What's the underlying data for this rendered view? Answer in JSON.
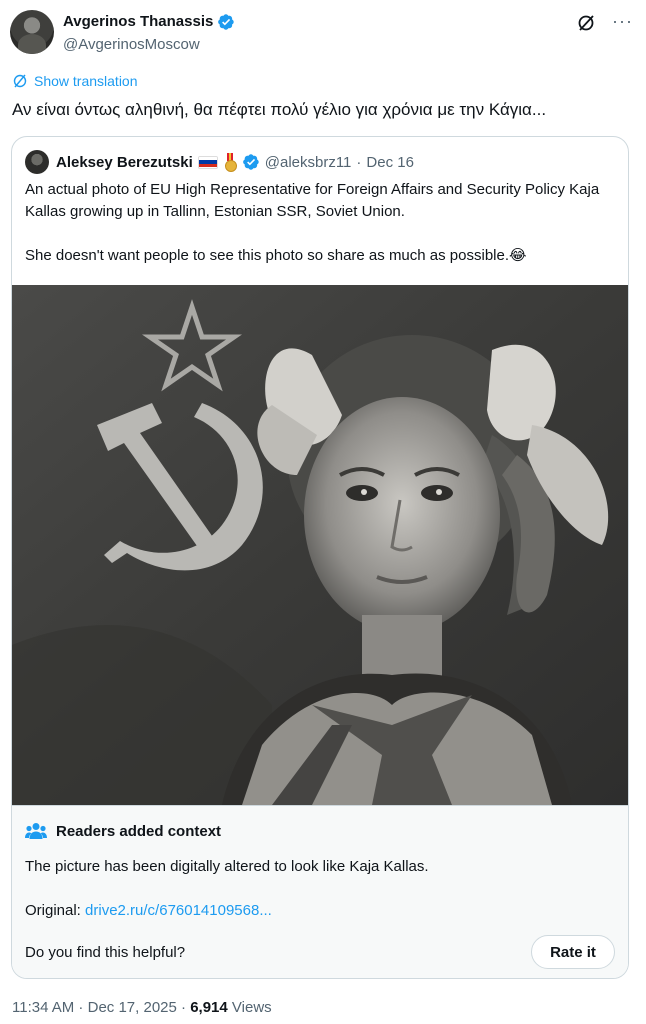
{
  "author": {
    "display_name": "Avgerinos Thanassis",
    "handle": "@AvgerinosMoscow",
    "verified": true
  },
  "translation_link": "Show translation",
  "tweet_text": "Αν είναι όντως αληθινή, θα πέφτει πολύ γέλιο για χρόνια με την Κάγια...",
  "quoted": {
    "display_name": "Aleksey Berezutski",
    "flag_icon": "russia-flag-icon",
    "medal_icon": "medal-icon",
    "handle": "@aleksbrz11",
    "separator": "·",
    "date": "Dec 16",
    "text_p1": "An actual photo of EU High Representative for Foreign Affairs and Security Policy Kaja Kallas growing up in Tallinn, Estonian SSR, Soviet Union.",
    "text_p2": "She doesn't want people to see this photo so share as much as possible.😂"
  },
  "context": {
    "title": "Readers added context",
    "body": "The picture has been digitally altered to look like Kaja Kallas.",
    "original_label": "Original:",
    "original_link": "drive2.ru/c/676014109568...",
    "helpful_question": "Do you find this helpful?",
    "rate_button": "Rate it"
  },
  "footer": {
    "time": "11:34 AM",
    "sep1": " · ",
    "date": "Dec 17, 2025",
    "sep2": " · ",
    "views_count": "6,914",
    "views_label": "Views"
  },
  "colors": {
    "accent": "#1d9bf0",
    "text": "#0f1419",
    "muted": "#536471",
    "border": "#cfd9de"
  }
}
